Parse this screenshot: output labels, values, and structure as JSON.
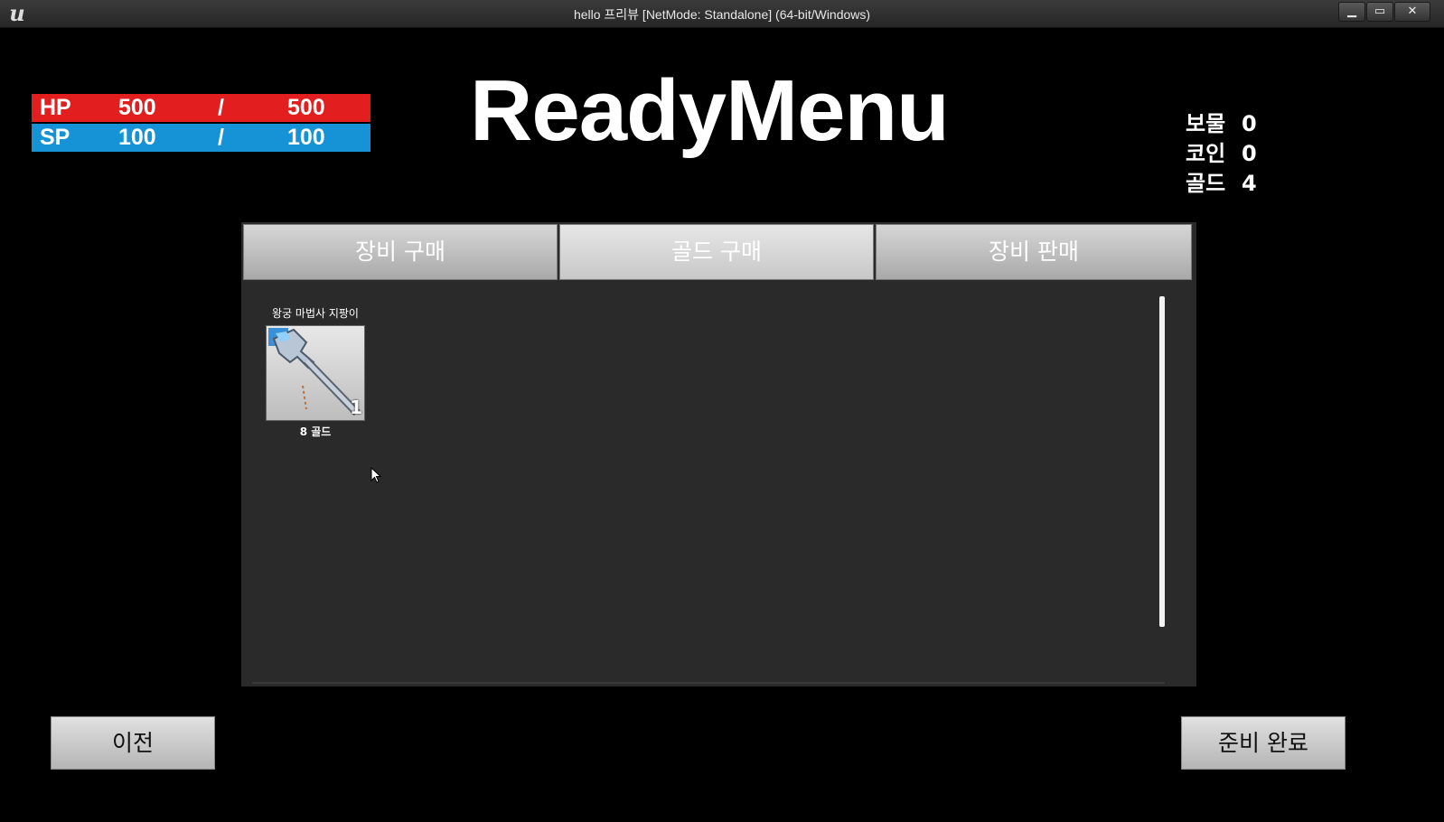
{
  "window": {
    "title": "hello 프리뷰 [NetMode: Standalone] (64-bit/Windows)",
    "logo_glyph": "u",
    "minimize_glyph": "▁",
    "maximize_glyph": "▭",
    "close_glyph": "✕"
  },
  "status": {
    "hp": {
      "label": "HP",
      "current": "500",
      "separator": "/",
      "max": "500",
      "color": "#e31e1e"
    },
    "sp": {
      "label": "SP",
      "current": "100",
      "separator": "/",
      "max": "100",
      "color": "#1593d6"
    }
  },
  "title": "ReadyMenu",
  "currencies": [
    {
      "name": "보물",
      "value": "0"
    },
    {
      "name": "코인",
      "value": "0"
    },
    {
      "name": "골드",
      "value": "4"
    }
  ],
  "shop": {
    "tabs": [
      {
        "label": "장비 구매"
      },
      {
        "label": "골드 구매"
      },
      {
        "label": "장비 판매"
      }
    ],
    "items": [
      {
        "name": "왕궁 마법사 지팡이",
        "icon": "wizard-staff-icon",
        "quantity": "1",
        "price": "8 골드"
      }
    ]
  },
  "buttons": {
    "prev": "이전",
    "ready": "준비 완료"
  }
}
